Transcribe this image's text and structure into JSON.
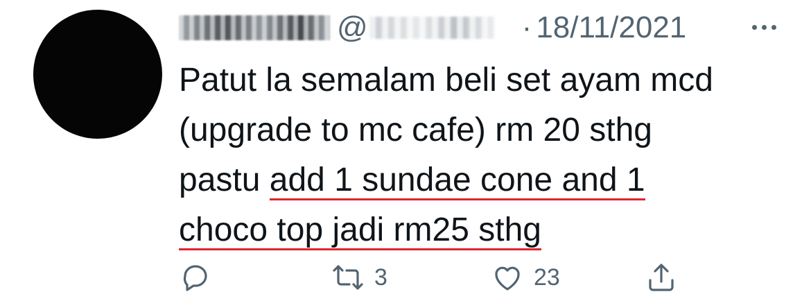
{
  "tweet": {
    "display_name": "",
    "handle_prefix": "@",
    "separator": "·",
    "date": "18/11/2021",
    "text": {
      "line1": "Patut la semalam beli set ayam mcd",
      "line2": "(upgrade to mc cafe) rm 20 sthg",
      "line3_plain": "pastu ",
      "line3_underlined": "add 1 sundae cone and 1",
      "line4_underlined": "choco top jadi rm25 sthg"
    },
    "actions": {
      "reply_count": "",
      "retweet_count": "3",
      "like_count": "23",
      "share_count": ""
    }
  },
  "colors": {
    "text": "#0f1419",
    "secondary": "#536471",
    "underline": "#e0242d"
  },
  "icons": [
    "reply-icon",
    "retweet-icon",
    "like-icon",
    "share-icon",
    "more-icon"
  ]
}
